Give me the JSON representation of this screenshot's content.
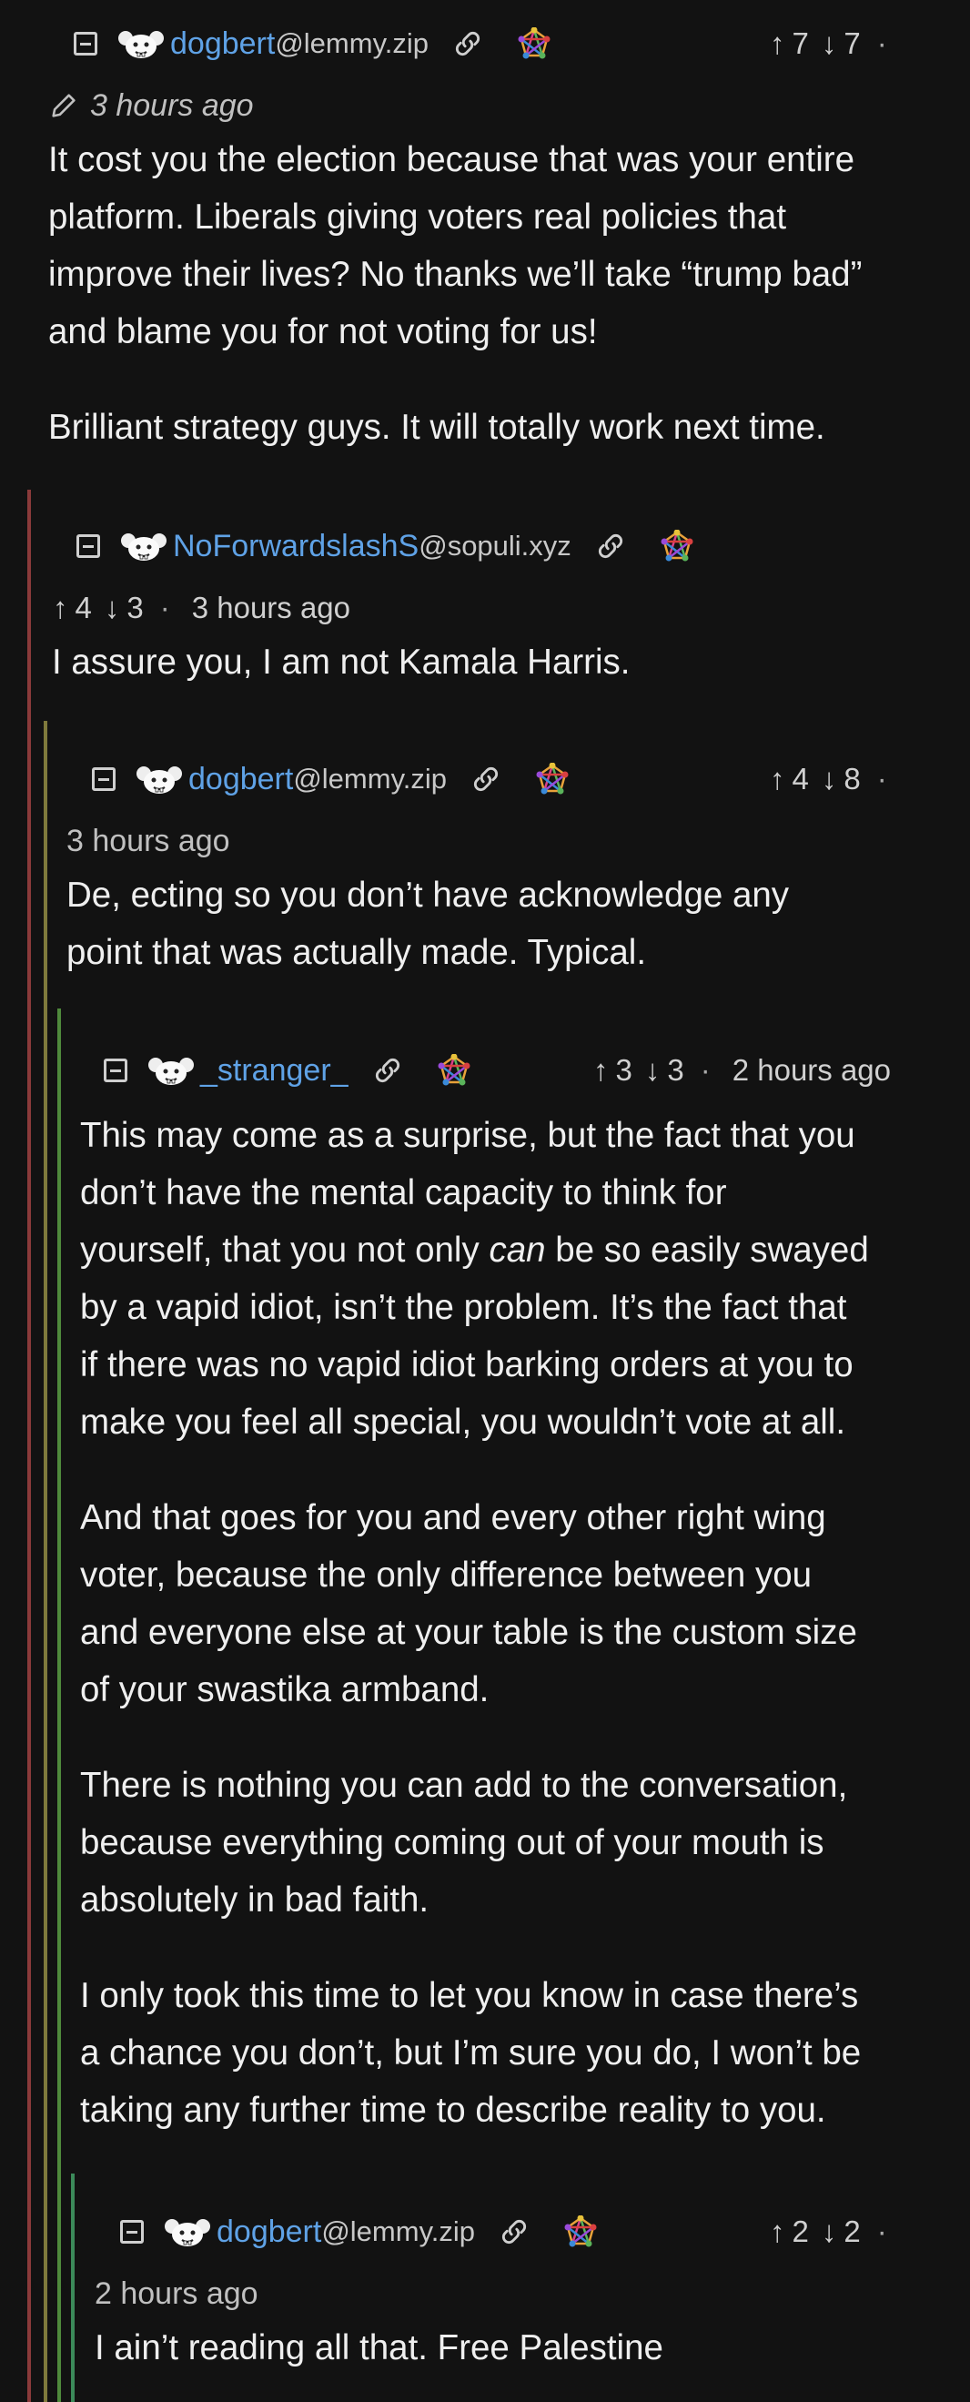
{
  "comments": [
    {
      "username": "dogbert",
      "instance": "@lemmy.zip",
      "upvotes": "7",
      "downvotes": "7",
      "time": "3 hours ago",
      "edited": true,
      "paragraphs": [
        [
          "It cost you the election because that was your entire",
          "platform. Liberals giving voters real policies that",
          "improve their lives? No thanks we’ll take “trump bad”",
          "and blame you for not voting for us!"
        ],
        [
          "Brilliant strategy guys. It will totally work next time."
        ]
      ]
    },
    {
      "username": "NoForwardslashS",
      "instance": "@sopuli.xyz",
      "upvotes": "4",
      "downvotes": "3",
      "time": "3 hours ago",
      "paragraphs": [
        [
          "I assure you, I am not Kamala Harris."
        ]
      ]
    },
    {
      "username": "dogbert",
      "instance": "@lemmy.zip",
      "upvotes": "4",
      "downvotes": "8",
      "time": "3 hours ago",
      "paragraphs": [
        [
          "De, ecting so you don’t have acknowledge any",
          "point that was actually made. Typical."
        ]
      ]
    },
    {
      "username": "_stranger_",
      "instance": "",
      "upvotes": "3",
      "downvotes": "3",
      "time": "2 hours ago",
      "paragraphs": [
        [
          "This may come as a surprise, but the fact that you",
          "don’t have the mental capacity to think for",
          "yourself, that you not only can be so easily swayed",
          "by a vapid idiot, isn’t the problem. It’s the fact that",
          "if there was no vapid idiot barking orders at you to",
          "make you feel all special, you wouldn’t vote at all."
        ],
        [
          "And that goes for you and every other right wing",
          "voter, because the only difference between you",
          "and everyone else at your table is the custom size",
          "of your swastika armband."
        ],
        [
          "There is nothing you can add to the conversation,",
          "because everything coming out of your mouth is",
          "absolutely in bad faith."
        ],
        [
          "I only took this time to let you know in case there’s",
          "a chance you don’t, but I’m sure you do, I won’t be",
          "taking any further time to describe reality to you."
        ]
      ]
    },
    {
      "username": "dogbert",
      "instance": "@lemmy.zip",
      "upvotes": "2",
      "downvotes": "2",
      "time": "2 hours ago",
      "paragraphs": [
        [
          "I ain’t reading all that. Free Palestine"
        ]
      ]
    }
  ],
  "colors": {
    "background": "#121212",
    "username": "#5fa2e6",
    "rail_level1": "#8a3a3a",
    "rail_level2": "#7f7a3c",
    "rail_level3": "#4f8a3c",
    "rail_level4": "#3c8a5a"
  },
  "icons": [
    "collapse-icon",
    "avatar-icon",
    "link-icon",
    "fediverse-icon",
    "upvote-icon",
    "downvote-icon",
    "edit-pencil-icon"
  ]
}
